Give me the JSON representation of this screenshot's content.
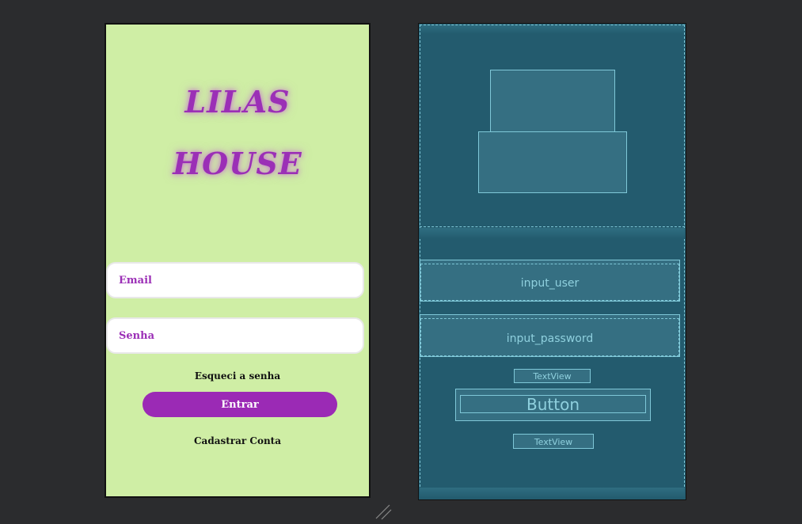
{
  "design": {
    "title_line1": "LILAS",
    "title_line2": "HOUSE",
    "email_placeholder": "Email",
    "password_placeholder": "Senha",
    "forgot_label": "Esqueci a senha",
    "login_button": "Entrar",
    "signup_label": "Cadastrar Conta",
    "colors": {
      "background": "#cfeea5",
      "accent": "#9b2fb6",
      "button": "#9b2ab5"
    }
  },
  "blueprint": {
    "input_user_label": "input_user",
    "input_password_label": "input_password",
    "textview1_label": "TextView",
    "button_label": "Button",
    "textview2_label": "TextView",
    "colors": {
      "background": "#235b6e",
      "outline": "#7fc8d8"
    }
  }
}
